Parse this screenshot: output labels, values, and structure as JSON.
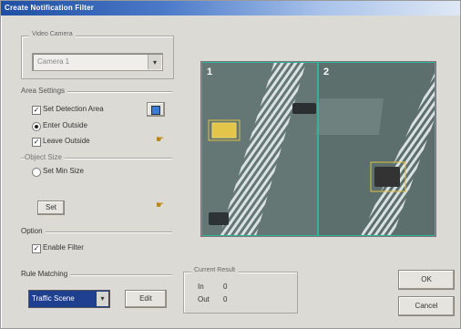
{
  "window": {
    "title": "Create Notification Filter"
  },
  "video_group": {
    "title": "Video Camera",
    "camera_select": "Camera 1"
  },
  "area_settings": {
    "title": "Area Settings",
    "set_detection_area": "Set Detection Area",
    "enter_outside": "Enter Outside",
    "leave_outside": "Leave Outside",
    "enter_outside_selected": true,
    "leave_outside_checked": true,
    "set_detection_checked": true
  },
  "object_size": {
    "title": "Object Size",
    "set_min_size": "Set Min Size",
    "button_label": "Set"
  },
  "options": {
    "title": "Option",
    "checkbox_label": "Enable Filter",
    "checked": true
  },
  "rule_matching": {
    "title": "Rule Matching",
    "select_value": "Traffic Scene",
    "edit_label": "Edit"
  },
  "current_result": {
    "title": "Current Result",
    "line1_label": "In",
    "line1_value": "0",
    "line2_label": "Out",
    "line2_value": "0"
  },
  "buttons": {
    "ok": "OK",
    "cancel": "Cancel"
  },
  "video_view": {
    "camera1_label": "1",
    "camera2_label": "2"
  },
  "colors": {
    "title_start": "#1f4fa3",
    "selection": "#1f3f8f",
    "divider": "#2fb39a",
    "box": "#e0c040"
  }
}
